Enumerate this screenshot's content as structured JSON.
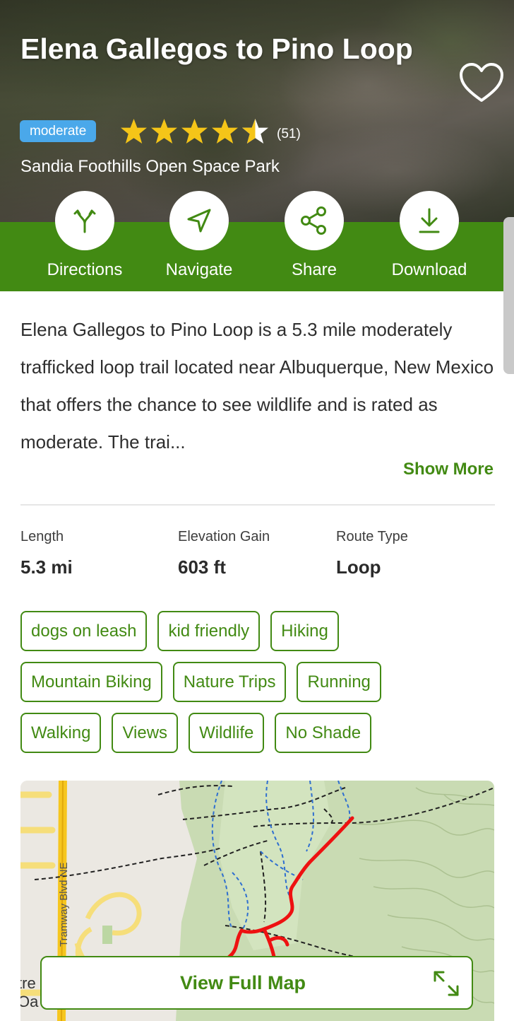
{
  "trail": {
    "title": "Elena Gallegos to Pino Loop",
    "difficulty": "moderate",
    "rating": 4.5,
    "review_count": "(51)",
    "park": "Sandia Foothills Open Space Park"
  },
  "actions": [
    {
      "label": "Directions",
      "icon": "fork-arrows-icon"
    },
    {
      "label": "Navigate",
      "icon": "navigate-arrow-icon"
    },
    {
      "label": "Share",
      "icon": "share-icon"
    },
    {
      "label": "Download",
      "icon": "download-icon"
    }
  ],
  "description": {
    "text": "Elena Gallegos to Pino Loop is a 5.3 mile moderately trafficked loop trail located near Albuquerque, New Mexico that offers the chance to see wildlife and is rated as moderate. The trai...",
    "show_more": "Show More"
  },
  "stats": [
    {
      "label": "Length",
      "value": "5.3 mi"
    },
    {
      "label": "Elevation Gain",
      "value": "603 ft"
    },
    {
      "label": "Route Type",
      "value": "Loop"
    }
  ],
  "tags": [
    [
      "dogs on leash",
      "kid friendly",
      "Hiking"
    ],
    [
      "Mountain Biking",
      "Nature Trips",
      "Running"
    ],
    [
      "Walking",
      "Views",
      "Wildlife",
      "No Shade"
    ]
  ],
  "map": {
    "street_label": "Tramway Blvd NE",
    "edge_label_1": "tre",
    "edge_label_2": "Oa",
    "button_label": "View Full Map"
  },
  "colors": {
    "brand_green": "#428a13",
    "badge_blue": "#4aa8ea",
    "star_gold": "#f5c518",
    "trail_red": "#ee1111"
  }
}
